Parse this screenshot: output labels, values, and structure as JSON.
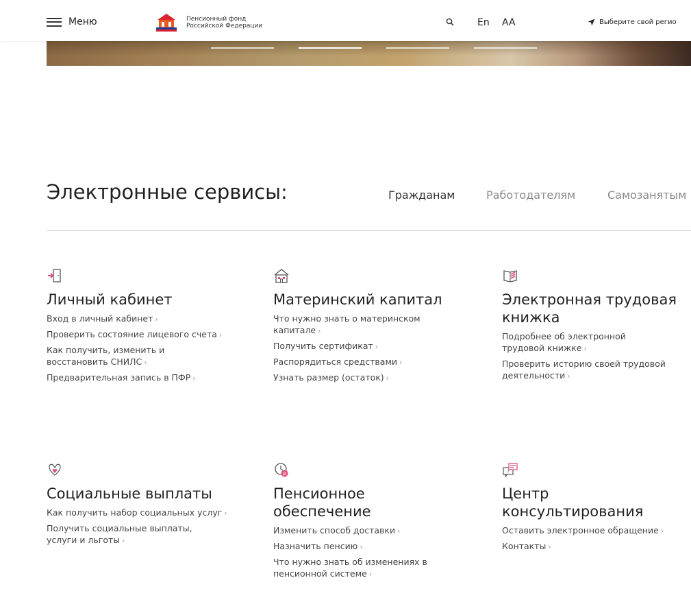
{
  "header": {
    "menu_label": "Меню",
    "logo_line1": "Пенсионный фонд",
    "logo_line2": "Российской Федерации",
    "lang": "En",
    "font_size": "AA",
    "region": "Выберите свой регио"
  },
  "services": {
    "title": "Электронные сервисы:",
    "tabs": [
      "Гражданам",
      "Работодателям",
      "Самозанятым"
    ],
    "active_tab": "Гражданам",
    "arrow": "›",
    "cards": [
      {
        "title": "Личный кабинет",
        "icon": "door-icon",
        "links": [
          "Вход в личный кабинет",
          "Проверить состояние лицевого счета",
          "Как получить, изменить и восстановить СНИЛС",
          "Предварительная запись в ПФР"
        ]
      },
      {
        "title": "Материнский капитал",
        "icon": "house-icon",
        "links": [
          "Что нужно знать о материнском капитале",
          "Получить сертификат",
          "Распорядиться средствами",
          "Узнать размер (остаток)"
        ]
      },
      {
        "title": "Электронная трудовая книжка",
        "icon": "book-icon",
        "links": [
          "Подробнее об электронной трудовой книжке",
          "Проверить историю своей трудовой деятельности"
        ]
      },
      {
        "title": "Социальные выплаты",
        "icon": "hands-heart-icon",
        "links": [
          "Как получить набор социальных услуг",
          "Получить социальные выплаты, услуги и льготы"
        ]
      },
      {
        "title": "Пенсионное обеспечение",
        "icon": "clock-ruble-icon",
        "links": [
          "Изменить способ доставки",
          "Назначить пенсию",
          "Что нужно знать об изменениях в пенсионной системе"
        ]
      },
      {
        "title": "Центр консультирования",
        "icon": "chat-question-icon",
        "links": [
          "Оставить электронное обращение",
          "Контакты"
        ]
      }
    ]
  },
  "colors": {
    "accent_red": "#d9232e",
    "accent_orange": "#e85a1f",
    "accent_blue": "#1f3fa0",
    "icon_pink": "#e0507a"
  }
}
